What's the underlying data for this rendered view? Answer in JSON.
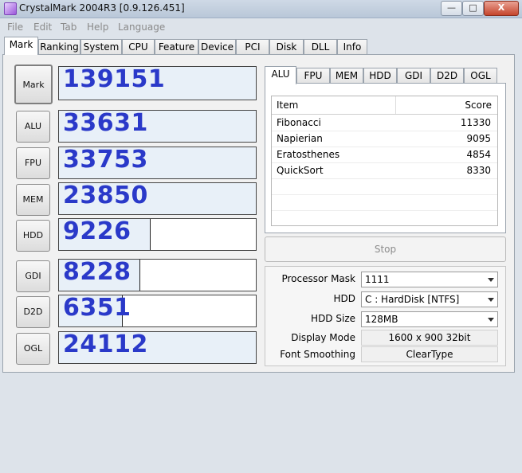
{
  "window": {
    "title": "CrystalMark 2004R3 [0.9.126.451]",
    "min_glyph": "—",
    "max_glyph": "□",
    "close_glyph": "X"
  },
  "menu": [
    "File",
    "Edit",
    "Tab",
    "Help",
    "Language"
  ],
  "tabs": [
    "Mark",
    "Ranking",
    "System",
    "CPU",
    "Feature",
    "Device",
    "PCI",
    "Disk",
    "DLL",
    "Info"
  ],
  "active_tab": "Mark",
  "scores": [
    {
      "label": "Mark",
      "value": "139151",
      "fill_pct": 100
    },
    {
      "label": "ALU",
      "value": "33631",
      "fill_pct": 100
    },
    {
      "label": "FPU",
      "value": "33753",
      "fill_pct": 100
    },
    {
      "label": "MEM",
      "value": "23850",
      "fill_pct": 100
    },
    {
      "label": "HDD",
      "value": "9226",
      "fill_pct": 46
    },
    {
      "label": "GDI",
      "value": "8228",
      "fill_pct": 41
    },
    {
      "label": "D2D",
      "value": "6351",
      "fill_pct": 32
    },
    {
      "label": "OGL",
      "value": "24112",
      "fill_pct": 100
    }
  ],
  "subtabs": [
    "ALU",
    "FPU",
    "MEM",
    "HDD",
    "GDI",
    "D2D",
    "OGL"
  ],
  "active_subtab": "ALU",
  "table": {
    "headers": {
      "item": "Item",
      "score": "Score"
    },
    "rows": [
      {
        "item": "Fibonacci",
        "score": "11330"
      },
      {
        "item": "Napierian",
        "score": "9095"
      },
      {
        "item": "Eratosthenes",
        "score": "4854"
      },
      {
        "item": "QuickSort",
        "score": "8330"
      }
    ]
  },
  "stop_label": "Stop",
  "settings": {
    "processor_mask_label": "Processor Mask",
    "processor_mask_value": "1111",
    "hdd_label": "HDD",
    "hdd_value": "C : HardDisk [NTFS]",
    "hdd_size_label": "HDD Size",
    "hdd_size_value": "128MB",
    "display_mode_label": "Display Mode",
    "display_mode_value": "1600 x 900 32bit",
    "font_smoothing_label": "Font Smoothing",
    "font_smoothing_value": "ClearType"
  }
}
